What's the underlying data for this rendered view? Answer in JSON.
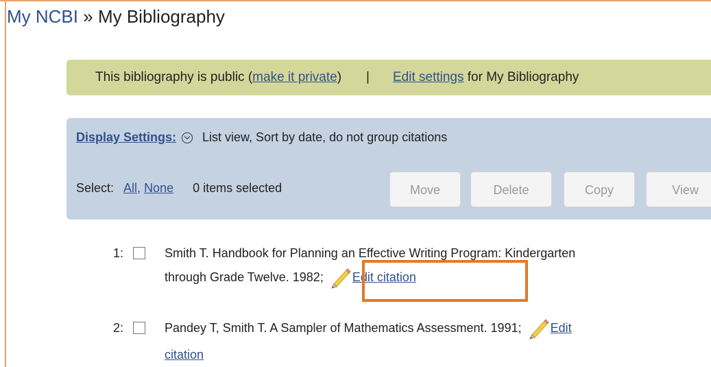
{
  "breadcrumb": {
    "home": "My NCBI",
    "separator": "»",
    "current": "My Bibliography"
  },
  "public_bar": {
    "text_before": "This bibliography is public (",
    "make_private_link": "make it private",
    "text_after_link": ")",
    "divider": "|",
    "edit_settings_link": "Edit settings",
    "text_suffix": " for My Bibliography"
  },
  "display_settings": {
    "label": "Display Settings:",
    "summary": "List view, Sort by date, do not group citations"
  },
  "selection": {
    "label": "Select:",
    "all_link": "All,",
    "none_link": "None",
    "count_text": "0 items selected"
  },
  "actions": {
    "move": "Move",
    "delete": "Delete",
    "copy": "Copy",
    "view": "View"
  },
  "citations": [
    {
      "number": "1:",
      "line1": "Smith T. Handbook for Planning an Effective Writing Program: Kindergarten",
      "line2": "through Grade Twelve. 1982;",
      "edit_link": "Edit citation"
    },
    {
      "number": "2:",
      "line1": "Pandey T, Smith T. A Sampler of Mathematics Assessment. 1991;",
      "edit_link_part1": "Edit",
      "edit_link_part2": "citation"
    }
  ],
  "colors": {
    "link": "#30508f",
    "public_bar_bg": "#d4d79a",
    "display_panel_bg": "#c5d2e2",
    "highlight": "#e07a2a",
    "frame": "#e8a26a"
  },
  "icons": {
    "edit": "pencil-icon",
    "display_toggle": "chevron-down-circle-icon"
  }
}
